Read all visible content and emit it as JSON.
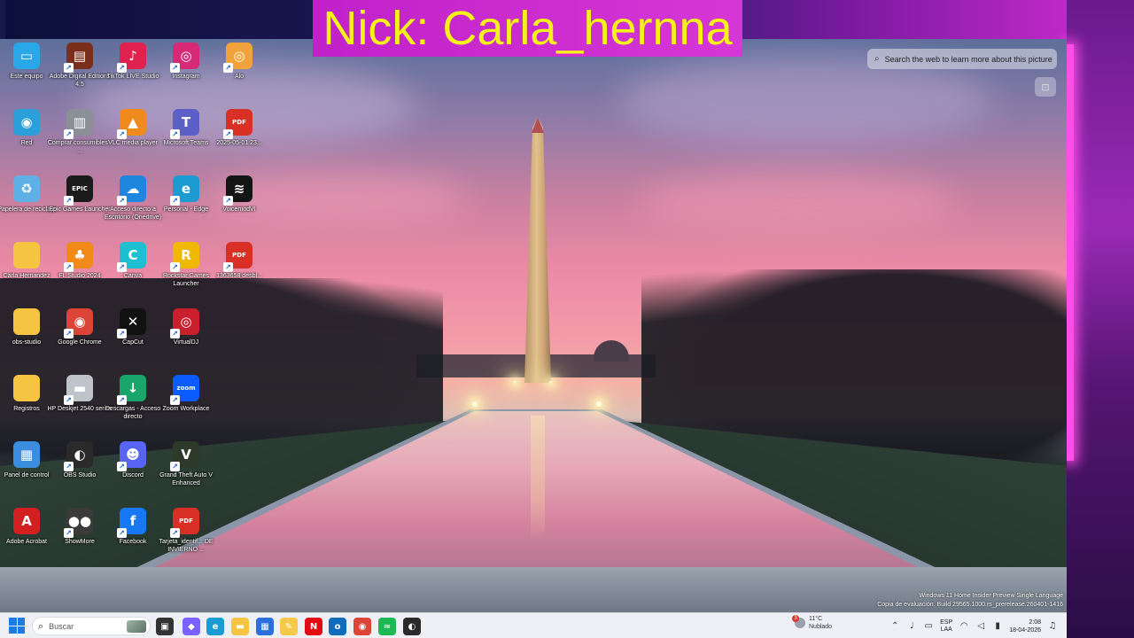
{
  "overlay": {
    "nick_text": "Nick: Carla_hernna",
    "colors": {
      "banner": "#c82bcc",
      "nick_text": "#f5f219",
      "neon": "#ff4de7"
    }
  },
  "lens": {
    "search_text": "Search the web to learn more about this picture",
    "icon": "lens-search-icon",
    "scan_icon": "visual-scan-icon"
  },
  "desktop_icons": [
    {
      "label": "Este equipo",
      "icon": "computer-icon",
      "glyph": "▭",
      "color": "#2aa7e8"
    },
    {
      "label": "Adobe Digital Editions 4.5",
      "icon": "adobe-digital-editions-icon",
      "glyph": "▤",
      "color": "#7a2f1c"
    },
    {
      "label": "TikTok LIVE Studio",
      "icon": "tiktok-icon",
      "glyph": "♪",
      "color": "#e0204f"
    },
    {
      "label": "Instagram",
      "icon": "instagram-icon",
      "glyph": "◎",
      "color": "#d62976"
    },
    {
      "label": "Alo",
      "icon": "alo-icon",
      "glyph": "◎",
      "color": "#f2a23a"
    },
    {
      "label": "Red",
      "icon": "network-icon",
      "glyph": "◉",
      "color": "#2b9fd9"
    },
    {
      "label": "Comprar consumibles - ...",
      "icon": "printer-icon",
      "glyph": "▥",
      "color": "#8b8f96"
    },
    {
      "label": "VLC media player",
      "icon": "vlc-icon",
      "glyph": "▲",
      "color": "#f08a1c"
    },
    {
      "label": "Microsoft Teams",
      "icon": "teams-icon",
      "glyph": "T",
      "color": "#5b5fc7"
    },
    {
      "label": "2025-05-01 23...",
      "icon": "pdf-icon",
      "glyph": "PDF",
      "color": "#d93025"
    },
    {
      "label": "Papelera de reciclaje",
      "icon": "recycle-bin-icon",
      "glyph": "♻",
      "color": "#5fb0e5"
    },
    {
      "label": "Epic Games Launcher",
      "icon": "epic-games-icon",
      "glyph": "EPIC",
      "color": "#1b1b1b"
    },
    {
      "label": "Acceso directo a Escritorio (Onedrive)",
      "icon": "onedrive-icon",
      "glyph": "☁",
      "color": "#1f86e0"
    },
    {
      "label": "Personal - Edge",
      "icon": "edge-icon",
      "glyph": "e",
      "color": "#1b9bd1"
    },
    {
      "label": "VoicemodVI",
      "icon": "voicemod-icon",
      "glyph": "≋",
      "color": "#141414"
    },
    {
      "label": "Carla Hernandez",
      "icon": "folder-icon",
      "glyph": "",
      "color": "#f5c542"
    },
    {
      "label": "FL Studio 2024",
      "icon": "fl-studio-icon",
      "glyph": "♣",
      "color": "#f28a1a"
    },
    {
      "label": "Canva",
      "icon": "canva-icon",
      "glyph": "C",
      "color": "#1ebfd0"
    },
    {
      "label": "Rockstar Games Launcher",
      "icon": "rockstar-icon",
      "glyph": "R",
      "color": "#f0b800"
    },
    {
      "label": "1363658 desbl...",
      "icon": "pdf-icon",
      "glyph": "PDF",
      "color": "#d93025"
    },
    {
      "label": "obs-studio",
      "icon": "folder-icon",
      "glyph": "",
      "color": "#f5c542"
    },
    {
      "label": "Google Chrome",
      "icon": "chrome-icon",
      "glyph": "◉",
      "color": "#db4437"
    },
    {
      "label": "CapCut",
      "icon": "capcut-icon",
      "glyph": "✕",
      "color": "#111111"
    },
    {
      "label": "VirtualDJ",
      "icon": "virtualdj-icon",
      "glyph": "◎",
      "color": "#cc1f2d"
    },
    {
      "label": "",
      "icon": "blank-icon",
      "glyph": "",
      "color": "transparent"
    },
    {
      "label": "Registros",
      "icon": "folder-icon",
      "glyph": "",
      "color": "#f5c542"
    },
    {
      "label": "HP Deskjet 2540 series",
      "icon": "hp-printer-icon",
      "glyph": "▬",
      "color": "#bfc4cb"
    },
    {
      "label": "Descargas - Acceso directo",
      "icon": "downloads-folder-icon",
      "glyph": "↓",
      "color": "#1aa56b"
    },
    {
      "label": "Zoom Workplace",
      "icon": "zoom-icon",
      "glyph": "zoom",
      "color": "#0b5cff"
    },
    {
      "label": "",
      "icon": "blank-icon",
      "glyph": "",
      "color": "transparent"
    },
    {
      "label": "Panel de control",
      "icon": "control-panel-icon",
      "glyph": "▦",
      "color": "#3b8de0"
    },
    {
      "label": "OBS Studio",
      "icon": "obs-icon",
      "glyph": "◐",
      "color": "#2a2a2a"
    },
    {
      "label": "Discord",
      "icon": "discord-icon",
      "glyph": "☻",
      "color": "#5865f2"
    },
    {
      "label": "Grand Theft Auto V Enhanced",
      "icon": "gta-icon",
      "glyph": "V",
      "color": "#2d3a2a"
    },
    {
      "label": "",
      "icon": "blank-icon",
      "glyph": "",
      "color": "transparent"
    },
    {
      "label": "Adobe Acrobat",
      "icon": "acrobat-icon",
      "glyph": "A",
      "color": "#d21f1f"
    },
    {
      "label": "ShowMore",
      "icon": "showmore-icon",
      "glyph": "●●",
      "color": "#3a3a3a"
    },
    {
      "label": "Facebook",
      "icon": "facebook-icon",
      "glyph": "f",
      "color": "#1877f2"
    },
    {
      "label": "Tarjeta_identif... DE INVIERNO ...",
      "icon": "pdf-icon",
      "glyph": "PDF",
      "color": "#d93025"
    }
  ],
  "watermark": {
    "line1": "Windows 11 Home Insider Preview Single Language",
    "line2": "Copia de evaluación. Build 29565.1000.rs_prerelease.260401-1416"
  },
  "taskbar": {
    "search_placeholder": "Buscar",
    "apps": [
      {
        "name": "task-view",
        "icon": "task-view-icon",
        "glyph": "▣",
        "color": "#333333"
      },
      {
        "name": "copilot",
        "icon": "copilot-icon",
        "glyph": "◆",
        "color": "#7b61ff"
      },
      {
        "name": "edge",
        "icon": "edge-icon",
        "glyph": "e",
        "color": "#1b9bd1"
      },
      {
        "name": "file-explorer",
        "icon": "folder-icon",
        "glyph": "▬",
        "color": "#f5c542"
      },
      {
        "name": "microsoft-store",
        "icon": "store-icon",
        "glyph": "▦",
        "color": "#2a6fdb"
      },
      {
        "name": "sticky-notes",
        "icon": "notes-icon",
        "glyph": "✎",
        "color": "#f7c948"
      },
      {
        "name": "netflix",
        "icon": "netflix-icon",
        "glyph": "N",
        "color": "#e50914"
      },
      {
        "name": "outlook",
        "icon": "outlook-icon",
        "glyph": "o",
        "color": "#0f6cbd"
      },
      {
        "name": "chrome",
        "icon": "chrome-icon",
        "glyph": "◉",
        "color": "#db4437"
      },
      {
        "name": "spotify",
        "icon": "spotify-icon",
        "glyph": "≈",
        "color": "#1db954"
      },
      {
        "name": "obs",
        "icon": "obs-icon",
        "glyph": "◐",
        "color": "#2a2a2a"
      }
    ],
    "weather": {
      "badge": "3",
      "temp": "11°C",
      "condition": "Nublado"
    },
    "language": {
      "top": "ESP",
      "bottom": "LAA"
    },
    "clock": {
      "time": "2:08",
      "date": "18-04-2026"
    }
  }
}
